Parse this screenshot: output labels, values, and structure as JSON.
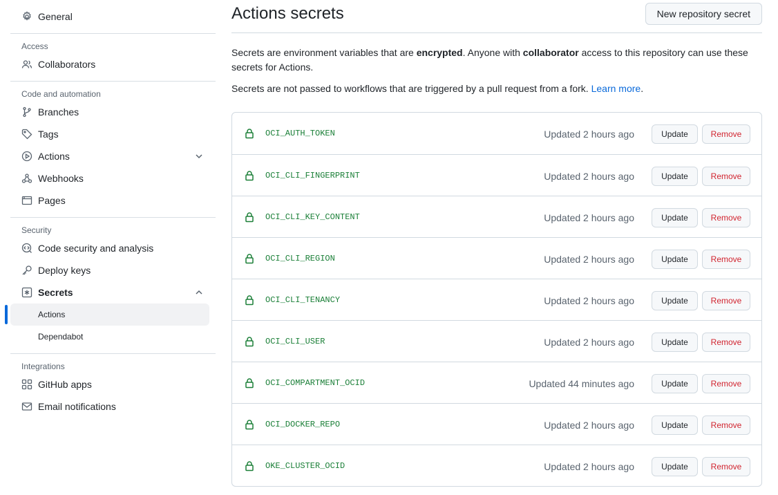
{
  "sidebar": {
    "general": "General",
    "access_title": "Access",
    "collaborators": "Collaborators",
    "code_title": "Code and automation",
    "branches": "Branches",
    "tags": "Tags",
    "actions": "Actions",
    "webhooks": "Webhooks",
    "pages": "Pages",
    "security_title": "Security",
    "code_security": "Code security and analysis",
    "deploy_keys": "Deploy keys",
    "secrets": "Secrets",
    "secrets_actions": "Actions",
    "secrets_dependabot": "Dependabot",
    "integrations_title": "Integrations",
    "github_apps": "GitHub apps",
    "email_notifications": "Email notifications"
  },
  "main": {
    "title": "Actions secrets",
    "new_button": "New repository secret",
    "desc_part1": "Secrets are environment variables that are ",
    "desc_bold1": "encrypted",
    "desc_part2": ". Anyone with ",
    "desc_bold2": "collaborator",
    "desc_part3": " access to this repository can use these secrets for Actions.",
    "fork_note": "Secrets are not passed to workflows that are triggered by a pull request from a fork. ",
    "learn_more": "Learn more",
    "period": "."
  },
  "secrets": [
    {
      "name": "OCI_AUTH_TOKEN",
      "updated": "Updated 2 hours ago"
    },
    {
      "name": "OCI_CLI_FINGERPRINT",
      "updated": "Updated 2 hours ago"
    },
    {
      "name": "OCI_CLI_KEY_CONTENT",
      "updated": "Updated 2 hours ago"
    },
    {
      "name": "OCI_CLI_REGION",
      "updated": "Updated 2 hours ago"
    },
    {
      "name": "OCI_CLI_TENANCY",
      "updated": "Updated 2 hours ago"
    },
    {
      "name": "OCI_CLI_USER",
      "updated": "Updated 2 hours ago"
    },
    {
      "name": "OCI_COMPARTMENT_OCID",
      "updated": "Updated 44 minutes ago"
    },
    {
      "name": "OCI_DOCKER_REPO",
      "updated": "Updated 2 hours ago"
    },
    {
      "name": "OKE_CLUSTER_OCID",
      "updated": "Updated 2 hours ago"
    }
  ],
  "buttons": {
    "update": "Update",
    "remove": "Remove"
  },
  "colors": {
    "accent": "#0969da",
    "secret_green": "#1a7f37",
    "danger": "#d1242f"
  }
}
